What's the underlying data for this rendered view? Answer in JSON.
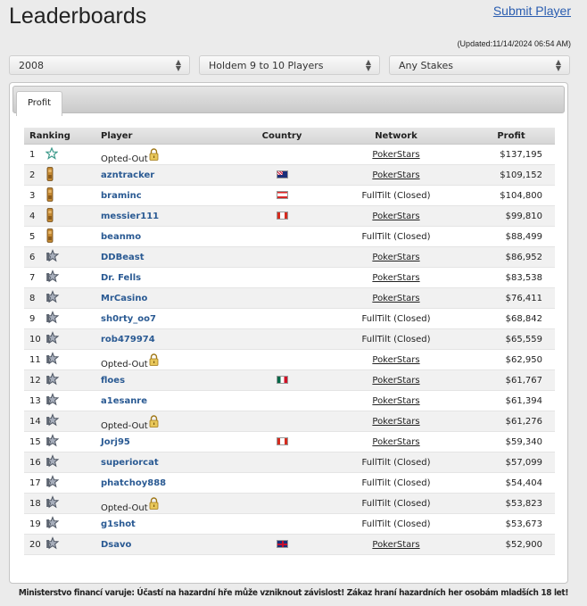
{
  "page": {
    "title": "Leaderboards",
    "submit_label": "Submit Player",
    "updated": "(Updated:11/14/2024 06:54 AM)"
  },
  "filters": {
    "year": "2008",
    "game": "Holdem 9 to 10 Players",
    "stakes": "Any Stakes"
  },
  "tab": {
    "label": "Profit"
  },
  "table": {
    "headers": {
      "ranking": "Ranking",
      "player": "Player",
      "country": "Country",
      "network": "Network",
      "profit": "Profit"
    },
    "rows": [
      {
        "rank": "1",
        "icon": "star-outline-icon",
        "player": "Opted-Out",
        "opted_out": true,
        "country": "",
        "network": "PokerStars",
        "net_link": true,
        "profit": "$137,195"
      },
      {
        "rank": "2",
        "icon": "bronze-figure-icon",
        "player": "azntracker",
        "opted_out": false,
        "country": "australia-flag",
        "network": "PokerStars",
        "net_link": true,
        "profit": "$109,152"
      },
      {
        "rank": "3",
        "icon": "bronze-figure-icon",
        "player": "braminc",
        "opted_out": false,
        "country": "lebanon-flag",
        "network": "FullTilt (Closed)",
        "net_link": false,
        "profit": "$104,800"
      },
      {
        "rank": "4",
        "icon": "bronze-figure-icon",
        "player": "messier111",
        "opted_out": false,
        "country": "canada-flag",
        "network": "PokerStars",
        "net_link": true,
        "profit": "$99,810"
      },
      {
        "rank": "5",
        "icon": "bronze-figure-icon",
        "player": "beanmo",
        "opted_out": false,
        "country": "",
        "network": "FullTilt (Closed)",
        "net_link": false,
        "profit": "$88,499"
      },
      {
        "rank": "6",
        "icon": "silver-figure-icon",
        "player": "DDBeast",
        "opted_out": false,
        "country": "",
        "network": "PokerStars",
        "net_link": true,
        "profit": "$86,952"
      },
      {
        "rank": "7",
        "icon": "silver-figure-icon",
        "player": "Dr. Fells",
        "opted_out": false,
        "country": "",
        "network": "PokerStars",
        "net_link": true,
        "profit": "$83,538"
      },
      {
        "rank": "8",
        "icon": "silver-figure-icon",
        "player": "MrCasino",
        "opted_out": false,
        "country": "",
        "network": "PokerStars",
        "net_link": true,
        "profit": "$76,411"
      },
      {
        "rank": "9",
        "icon": "silver-figure-icon",
        "player": "sh0rty_oo7",
        "opted_out": false,
        "country": "",
        "network": "FullTilt (Closed)",
        "net_link": false,
        "profit": "$68,842"
      },
      {
        "rank": "10",
        "icon": "silver-figure-icon",
        "player": "rob479974",
        "opted_out": false,
        "country": "",
        "network": "FullTilt (Closed)",
        "net_link": false,
        "profit": "$65,559"
      },
      {
        "rank": "11",
        "icon": "silver-figure-icon",
        "player": "Opted-Out",
        "opted_out": true,
        "country": "",
        "network": "PokerStars",
        "net_link": true,
        "profit": "$62,950"
      },
      {
        "rank": "12",
        "icon": "silver-figure-icon",
        "player": "floes",
        "opted_out": false,
        "country": "mexico-flag",
        "network": "PokerStars",
        "net_link": true,
        "profit": "$61,767"
      },
      {
        "rank": "13",
        "icon": "silver-figure-icon",
        "player": "a1esanre",
        "opted_out": false,
        "country": "",
        "network": "PokerStars",
        "net_link": true,
        "profit": "$61,394"
      },
      {
        "rank": "14",
        "icon": "silver-figure-icon",
        "player": "Opted-Out",
        "opted_out": true,
        "country": "",
        "network": "PokerStars",
        "net_link": true,
        "profit": "$61,276"
      },
      {
        "rank": "15",
        "icon": "silver-figure-icon",
        "player": "Jorj95",
        "opted_out": false,
        "country": "canada-flag",
        "network": "PokerStars",
        "net_link": true,
        "profit": "$59,340"
      },
      {
        "rank": "16",
        "icon": "silver-figure-icon",
        "player": "superiorcat",
        "opted_out": false,
        "country": "",
        "network": "FullTilt (Closed)",
        "net_link": false,
        "profit": "$57,099"
      },
      {
        "rank": "17",
        "icon": "silver-figure-icon",
        "player": "phatchoy888",
        "opted_out": false,
        "country": "",
        "network": "FullTilt (Closed)",
        "net_link": false,
        "profit": "$54,404"
      },
      {
        "rank": "18",
        "icon": "silver-figure-icon",
        "player": "Opted-Out",
        "opted_out": true,
        "country": "",
        "network": "FullTilt (Closed)",
        "net_link": false,
        "profit": "$53,823"
      },
      {
        "rank": "19",
        "icon": "silver-figure-icon",
        "player": "g1shot",
        "opted_out": false,
        "country": "",
        "network": "FullTilt (Closed)",
        "net_link": false,
        "profit": "$53,673"
      },
      {
        "rank": "20",
        "icon": "silver-figure-icon",
        "player": "Dsavo",
        "opted_out": false,
        "country": "uk-flag",
        "network": "PokerStars",
        "net_link": true,
        "profit": "$52,900"
      }
    ]
  },
  "footer": {
    "text": "Ministerstvo financí varuje: Účastí na hazardní hře může vzniknout závislost! Zákaz hraní hazardních her osobám mladších 18 let!"
  },
  "colors": {
    "link": "#2a5a93",
    "header_link": "#2a5db0",
    "bronze": "#b8822f",
    "silver": "#8a929e"
  }
}
